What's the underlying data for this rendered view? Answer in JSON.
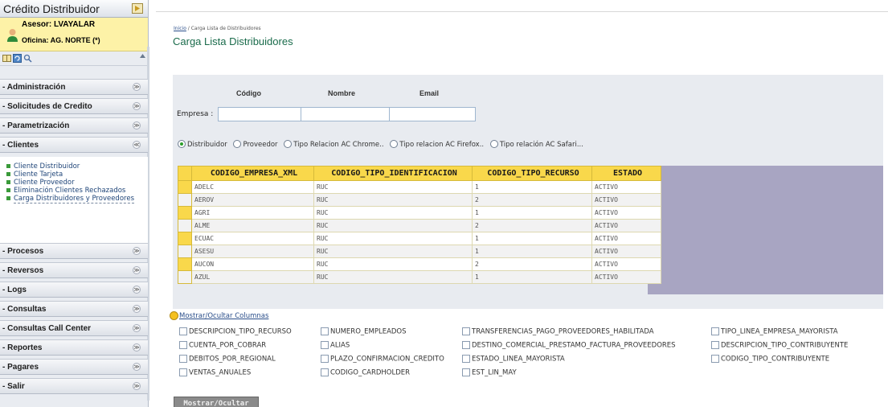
{
  "sidebar": {
    "title": "Crédito Distribuidor",
    "asesor": "Asesor: LVAYALAR",
    "oficina": "Oficina: AG. NORTE (*)",
    "menus": [
      {
        "label": "- Administración",
        "chev": "≫"
      },
      {
        "label": "- Solicitudes de Credito",
        "chev": "≫"
      },
      {
        "label": "- Parametrización",
        "chev": "≫"
      },
      {
        "label": "- Clientes",
        "chev": "≪"
      },
      {
        "label": "- Procesos",
        "chev": "≫"
      },
      {
        "label": "- Reversos",
        "chev": "≫"
      },
      {
        "label": "- Logs",
        "chev": "≫"
      },
      {
        "label": "- Consultas",
        "chev": "≫"
      },
      {
        "label": "- Consultas Call Center",
        "chev": "≫"
      },
      {
        "label": "- Reportes",
        "chev": "≫"
      },
      {
        "label": "- Pagares",
        "chev": "≫"
      },
      {
        "label": "- Salir",
        "chev": "≫"
      }
    ],
    "clientes_items": [
      "Cliente Distribuidor",
      "Cliente Tarjeta",
      "Cliente Proveedor",
      "Eliminación Clientes Rechazados",
      "Carga Distribuidores y Proveedores"
    ]
  },
  "main": {
    "breadcrumb_home": "Inicio",
    "breadcrumb_rest": " / Carga Lista de Distribuidores",
    "title": "Carga Lista Distribuidores",
    "filter_headers": [
      "Código",
      "Nombre",
      "Email"
    ],
    "empresa_label": "Empresa :",
    "radio_options": [
      {
        "label": "Distribuidor",
        "selected": true
      },
      {
        "label": "Proveedor",
        "selected": false
      },
      {
        "label": "Tipo Relacion AC Chrome..",
        "selected": false
      },
      {
        "label": "Tipo relacion AC Firefox..",
        "selected": false
      },
      {
        "label": "Tipo relación AC Safari...",
        "selected": false
      }
    ],
    "grid": {
      "columns": [
        "CODIGO_EMPRESA_XML",
        "CODIGO_TIPO_IDENTIFICACION",
        "CODIGO_TIPO_RECURSO",
        "ESTADO"
      ],
      "rows": [
        [
          "ADELC",
          "RUC",
          "1",
          "ACTIVO"
        ],
        [
          "AEROV",
          "RUC",
          "2",
          "ACTIVO"
        ],
        [
          "AGRI",
          "RUC",
          "1",
          "ACTIVO"
        ],
        [
          "ALME",
          "RUC",
          "2",
          "ACTIVO"
        ],
        [
          "ECUAC",
          "RUC",
          "1",
          "ACTIVO"
        ],
        [
          "ASESU",
          "RUC",
          "1",
          "ACTIVO"
        ],
        [
          "AUCON",
          "RUC",
          "2",
          "ACTIVO"
        ],
        [
          "AZUL",
          "RUC",
          "1",
          "ACTIVO"
        ]
      ]
    },
    "toggle_columns_label": "Mostrar/Ocultar Columnas",
    "column_checks": [
      "DESCRIPCION_TIPO_RECURSO",
      "CUENTA_POR_COBRAR",
      "DEBITOS_POR_REGIONAL",
      "VENTAS_ANUALES",
      "NUMERO_EMPLEADOS",
      "ALIAS",
      "PLAZO_CONFIRMACION_CREDITO",
      "CODIGO_CARDHOLDER",
      "TRANSFERENCIAS_PAGO_PROVEEDORES_HABILITADA",
      "DESTINO_COMERCIAL_PRESTAMO_FACTURA_PROVEEDORES",
      "ESTADO_LINEA_MAYORISTA",
      "EST_LIN_MAY",
      "TIPO_LINEA_EMPRESA_MAYORISTA",
      "DESCRIPCION_TIPO_CONTRIBUYENTE",
      "CODIGO_TIPO_CONTRIBUYENTE"
    ],
    "mostrar_button": "Mostrar/Ocultar"
  },
  "colors": {
    "grid_header": "#f9d84b",
    "grid_filler": "#a8a5c2",
    "title_green": "#1a6b4b",
    "user_box": "#fdf2a7"
  }
}
